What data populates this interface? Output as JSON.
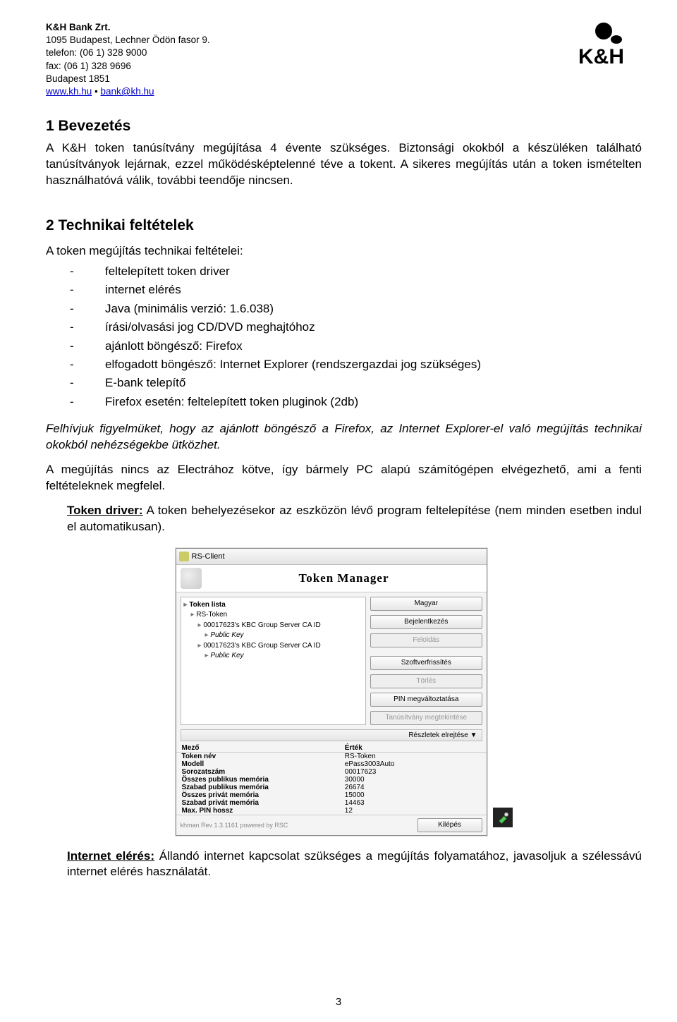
{
  "company": {
    "name": "K&H Bank Zrt.",
    "address": "1095 Budapest, Lechner Ödön fasor 9.",
    "phone": "telefon: (06 1) 328 9000",
    "fax": "fax: (06 1) 328 9696",
    "post": "Budapest 1851",
    "website": "www.kh.hu",
    "email": "bank@kh.hu",
    "separator": " • "
  },
  "logo_text": "K&H",
  "section1": {
    "title": "1  Bevezetés",
    "p1": "A K&H token tanúsítvány megújítása 4 évente szükséges. Biztonsági okokból a készüléken található tanúsítványok lejárnak, ezzel működésképtelenné téve a tokent. A sikeres megújítás után a token ismételten használhatóvá válik, további teendője nincsen."
  },
  "section2": {
    "title": "2  Technikai feltételek",
    "intro": "A token megújítás technikai feltételei:",
    "items": [
      "feltelepített token driver",
      "internet elérés",
      "Java (minimális verzió: 1.6.038)",
      "írási/olvasási jog CD/DVD meghajtóhoz",
      "ajánlott böngésző: Firefox",
      "elfogadott böngésző: Internet Explorer (rendszergazdai jog szükséges)",
      "E-bank telepítő",
      "Firefox esetén: feltelepített token pluginok (2db)"
    ],
    "italic_note": "Felhívjuk figyelmüket, hogy az ajánlott böngésző a Firefox, az Internet Explorer-el való megújítás technikai okokból nehézségekbe ütközhet.",
    "p_electra": "A megújítás nincs az Electrához kötve, így bármely PC alapú számítógépen elvégezhető, ami a fenti feltételeknek megfelel.",
    "token_driver_label": "Token driver:",
    "token_driver_text": " A token behelyezésekor az eszközön lévő program feltelepítése (nem minden esetben indul el automatikusan).",
    "internet_label": "Internet elérés:",
    "internet_text": " Állandó internet kapcsolat szükséges a megújítás folyamatához, javasoljuk a szélessávú internet elérés használatát."
  },
  "token_manager": {
    "window_title": "RS-Client",
    "banner_title": "Token Manager",
    "tree_header": "Token lista",
    "tree": [
      {
        "lvl": 1,
        "label": "RS-Token"
      },
      {
        "lvl": 2,
        "label": "00017623's KBC Group Server CA ID"
      },
      {
        "lvl": 3,
        "label": "Public Key"
      },
      {
        "lvl": 2,
        "label": "00017623's KBC Group Server CA ID"
      },
      {
        "lvl": 3,
        "label": "Public Key"
      }
    ],
    "buttons": {
      "lang": "Magyar",
      "login": "Bejelentkezés",
      "unlock": "Feloldás",
      "sw_refresh": "Szoftverfrissítés",
      "delete": "Törlés",
      "pin_change": "PIN megváltoztatása",
      "cert_renew": "Tanúsítvány megtekintése",
      "exit": "Kilépés"
    },
    "details_bar": "Részletek elrejtése  ▼",
    "table_headers": {
      "c1": "Mező",
      "c2": "Érték"
    },
    "table_rows": [
      {
        "c1": "Token név",
        "c2": "RS-Token"
      },
      {
        "c1": "Modell",
        "c2": "ePass3003Auto"
      },
      {
        "c1": "Sorozatszám",
        "c2": "00017623"
      },
      {
        "c1": "Összes publikus memória",
        "c2": "30000"
      },
      {
        "c1": "Szabad publikus memória",
        "c2": "26674"
      },
      {
        "c1": "Összes privát memória",
        "c2": "15000"
      },
      {
        "c1": "Szabad privát memória",
        "c2": "14463"
      },
      {
        "c1": "Max. PIN hossz",
        "c2": "12"
      }
    ],
    "footer_text": "khman Rev 1.3.1161 powered by RSC"
  },
  "page_number": "3"
}
